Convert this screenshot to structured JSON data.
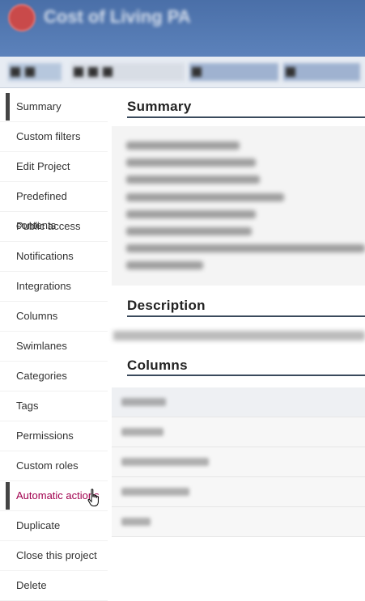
{
  "app": {
    "title": "Cost of Living PA"
  },
  "sidebar": {
    "items": [
      {
        "label": "Summary"
      },
      {
        "label": "Custom filters"
      },
      {
        "label": "Edit Project"
      },
      {
        "label": "Predefined contents"
      },
      {
        "label": "Public access"
      },
      {
        "label": "Notifications"
      },
      {
        "label": "Integrations"
      },
      {
        "label": "Columns"
      },
      {
        "label": "Swimlanes"
      },
      {
        "label": "Categories"
      },
      {
        "label": "Tags"
      },
      {
        "label": "Permissions"
      },
      {
        "label": "Custom roles"
      },
      {
        "label": "Automatic actions"
      },
      {
        "label": "Duplicate"
      },
      {
        "label": "Close this project"
      },
      {
        "label": "Delete"
      }
    ]
  },
  "main": {
    "summary_title": "Summary",
    "description_title": "Description",
    "columns_title": "Columns"
  },
  "colors": {
    "accent": "#a1004e",
    "header": "#4a6fa8",
    "rule": "#3a4a5c"
  }
}
